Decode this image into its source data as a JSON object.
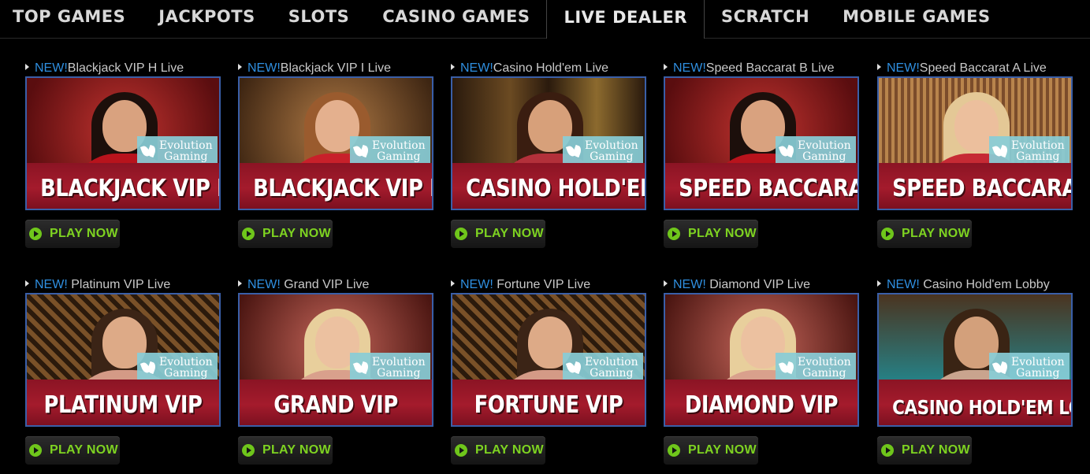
{
  "nav": {
    "tabs": [
      {
        "label": "TOP GAMES"
      },
      {
        "label": "JACKPOTS"
      },
      {
        "label": "SLOTS"
      },
      {
        "label": "CASINO GAMES"
      },
      {
        "label": "LIVE DEALER",
        "active": true
      },
      {
        "label": "SCRATCH"
      },
      {
        "label": "MOBILE GAMES"
      }
    ]
  },
  "provider_badge": {
    "line1": "Evolution",
    "line2": "Gaming"
  },
  "play_label": "PLAY NOW",
  "colors": {
    "new": "#2f8fe0",
    "play_green": "#7ed321",
    "thumb_border": "#3a5fa8",
    "band": "#a41b2c"
  },
  "games": [
    {
      "new": "NEW!",
      "title": "Blackjack VIP H Live",
      "name": "BLACKJACK VIP H",
      "theme": "red"
    },
    {
      "new": "NEW!",
      "title": "Blackjack VIP I Live",
      "name": "BLACKJACK VIP I",
      "theme": "gold"
    },
    {
      "new": "NEW!",
      "title": "Casino Hold'em Live",
      "name": "CASINO HOLD'EM",
      "theme": "bar"
    },
    {
      "new": "NEW!",
      "title": "Speed Baccarat B Live",
      "name": "SPEED BACCARAT B",
      "theme": "red"
    },
    {
      "new": "NEW!",
      "title": "Speed Baccarat A Live",
      "name": "SPEED BACCARAT A",
      "theme": "curtain"
    },
    {
      "new": "NEW! ",
      "title": "Platinum VIP Live",
      "name": "PLATINUM VIP",
      "theme": "lattice"
    },
    {
      "new": "NEW! ",
      "title": "Grand VIP Live",
      "name": "GRAND VIP",
      "theme": "rose"
    },
    {
      "new": "NEW! ",
      "title": "Fortune VIP Live",
      "name": "FORTUNE VIP",
      "theme": "lattice"
    },
    {
      "new": "NEW! ",
      "title": "Diamond VIP Live",
      "name": "DIAMOND VIP",
      "theme": "rose"
    },
    {
      "new": "NEW! ",
      "title": "Casino Hold'em Lobby",
      "name": "CASINO HOLD'EM LOBBY",
      "theme": "lobby"
    }
  ]
}
